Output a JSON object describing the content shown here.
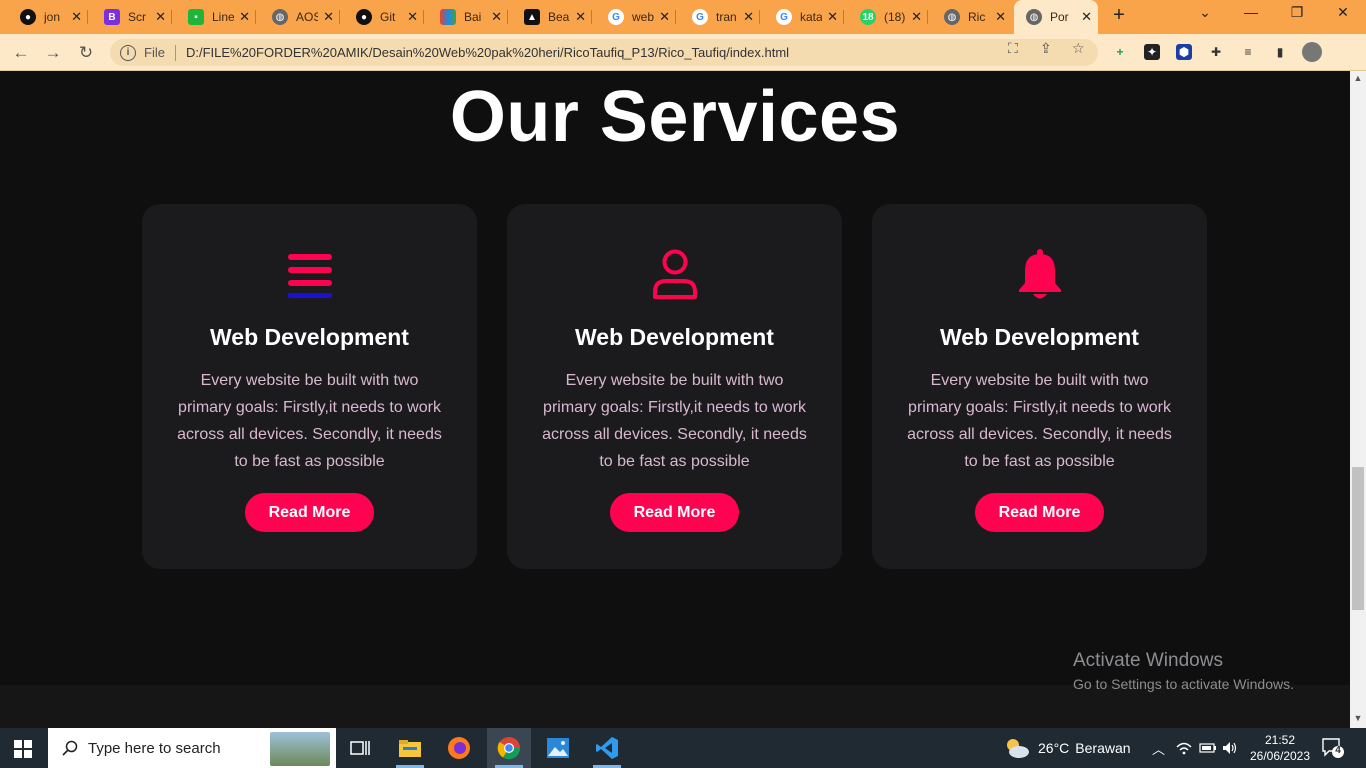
{
  "browser": {
    "tabs": [
      {
        "label": "jon",
        "favicon": "github-icon",
        "color": "#111111"
      },
      {
        "label": "Scr",
        "favicon": "bootstrap-icon",
        "color": "#7b2fe0"
      },
      {
        "label": "Line",
        "favicon": "line-icon",
        "color": "#1fb53a"
      },
      {
        "label": "AOS",
        "favicon": "globe-icon",
        "color": "#666666"
      },
      {
        "label": "Git",
        "favicon": "github-icon",
        "color": "#111111"
      },
      {
        "label": "Bai",
        "favicon": "colorful-icon",
        "color": "#e8432b"
      },
      {
        "label": "Bea",
        "favicon": "bea-icon",
        "color": "#111111"
      },
      {
        "label": "web",
        "favicon": "google-icon",
        "color": "#4285f4"
      },
      {
        "label": "tran",
        "favicon": "google-icon",
        "color": "#4285f4"
      },
      {
        "label": "kata",
        "favicon": "google-icon",
        "color": "#4285f4"
      },
      {
        "label": "(18)",
        "favicon": "whatsapp-icon",
        "color": "#25d366"
      },
      {
        "label": "Ric",
        "favicon": "globe-icon",
        "color": "#666666"
      },
      {
        "label": "Por",
        "favicon": "globe-icon",
        "color": "#666666"
      }
    ],
    "active_tab_index": 12,
    "address": {
      "scheme_label": "File",
      "url": "D:/FILE%20FORDER%20AMIK/Desain%20Web%20pak%20heri/RicoTaufiq_P13/Rico_Taufiq/index.html"
    }
  },
  "page": {
    "section_title": "Our Services",
    "cards": [
      {
        "icon": "bars-icon",
        "title": "Web Development",
        "text": "Every website be built with two primary goals: Firstly,it needs to work across all devices. Secondly, it needs to be fast as possible",
        "button": "Read More"
      },
      {
        "icon": "user-icon",
        "title": "Web Development",
        "text": "Every website be built with two primary goals: Firstly,it needs to work across all devices. Secondly, it needs to be fast as possible",
        "button": "Read More"
      },
      {
        "icon": "bell-icon",
        "title": "Web Development",
        "text": "Every website be built with two primary goals: Firstly,it needs to work across all devices. Secondly, it needs to be fast as possible",
        "button": "Read More"
      }
    ],
    "accent_color": "#ff0350",
    "watermark": {
      "line1": "Activate Windows",
      "line2": "Go to Settings to activate Windows."
    }
  },
  "taskbar": {
    "search_placeholder": "Type here to search",
    "weather": {
      "temp": "26°C",
      "condition": "Berawan"
    },
    "time": "21:52",
    "date": "26/06/2023",
    "notification_count": "4"
  }
}
